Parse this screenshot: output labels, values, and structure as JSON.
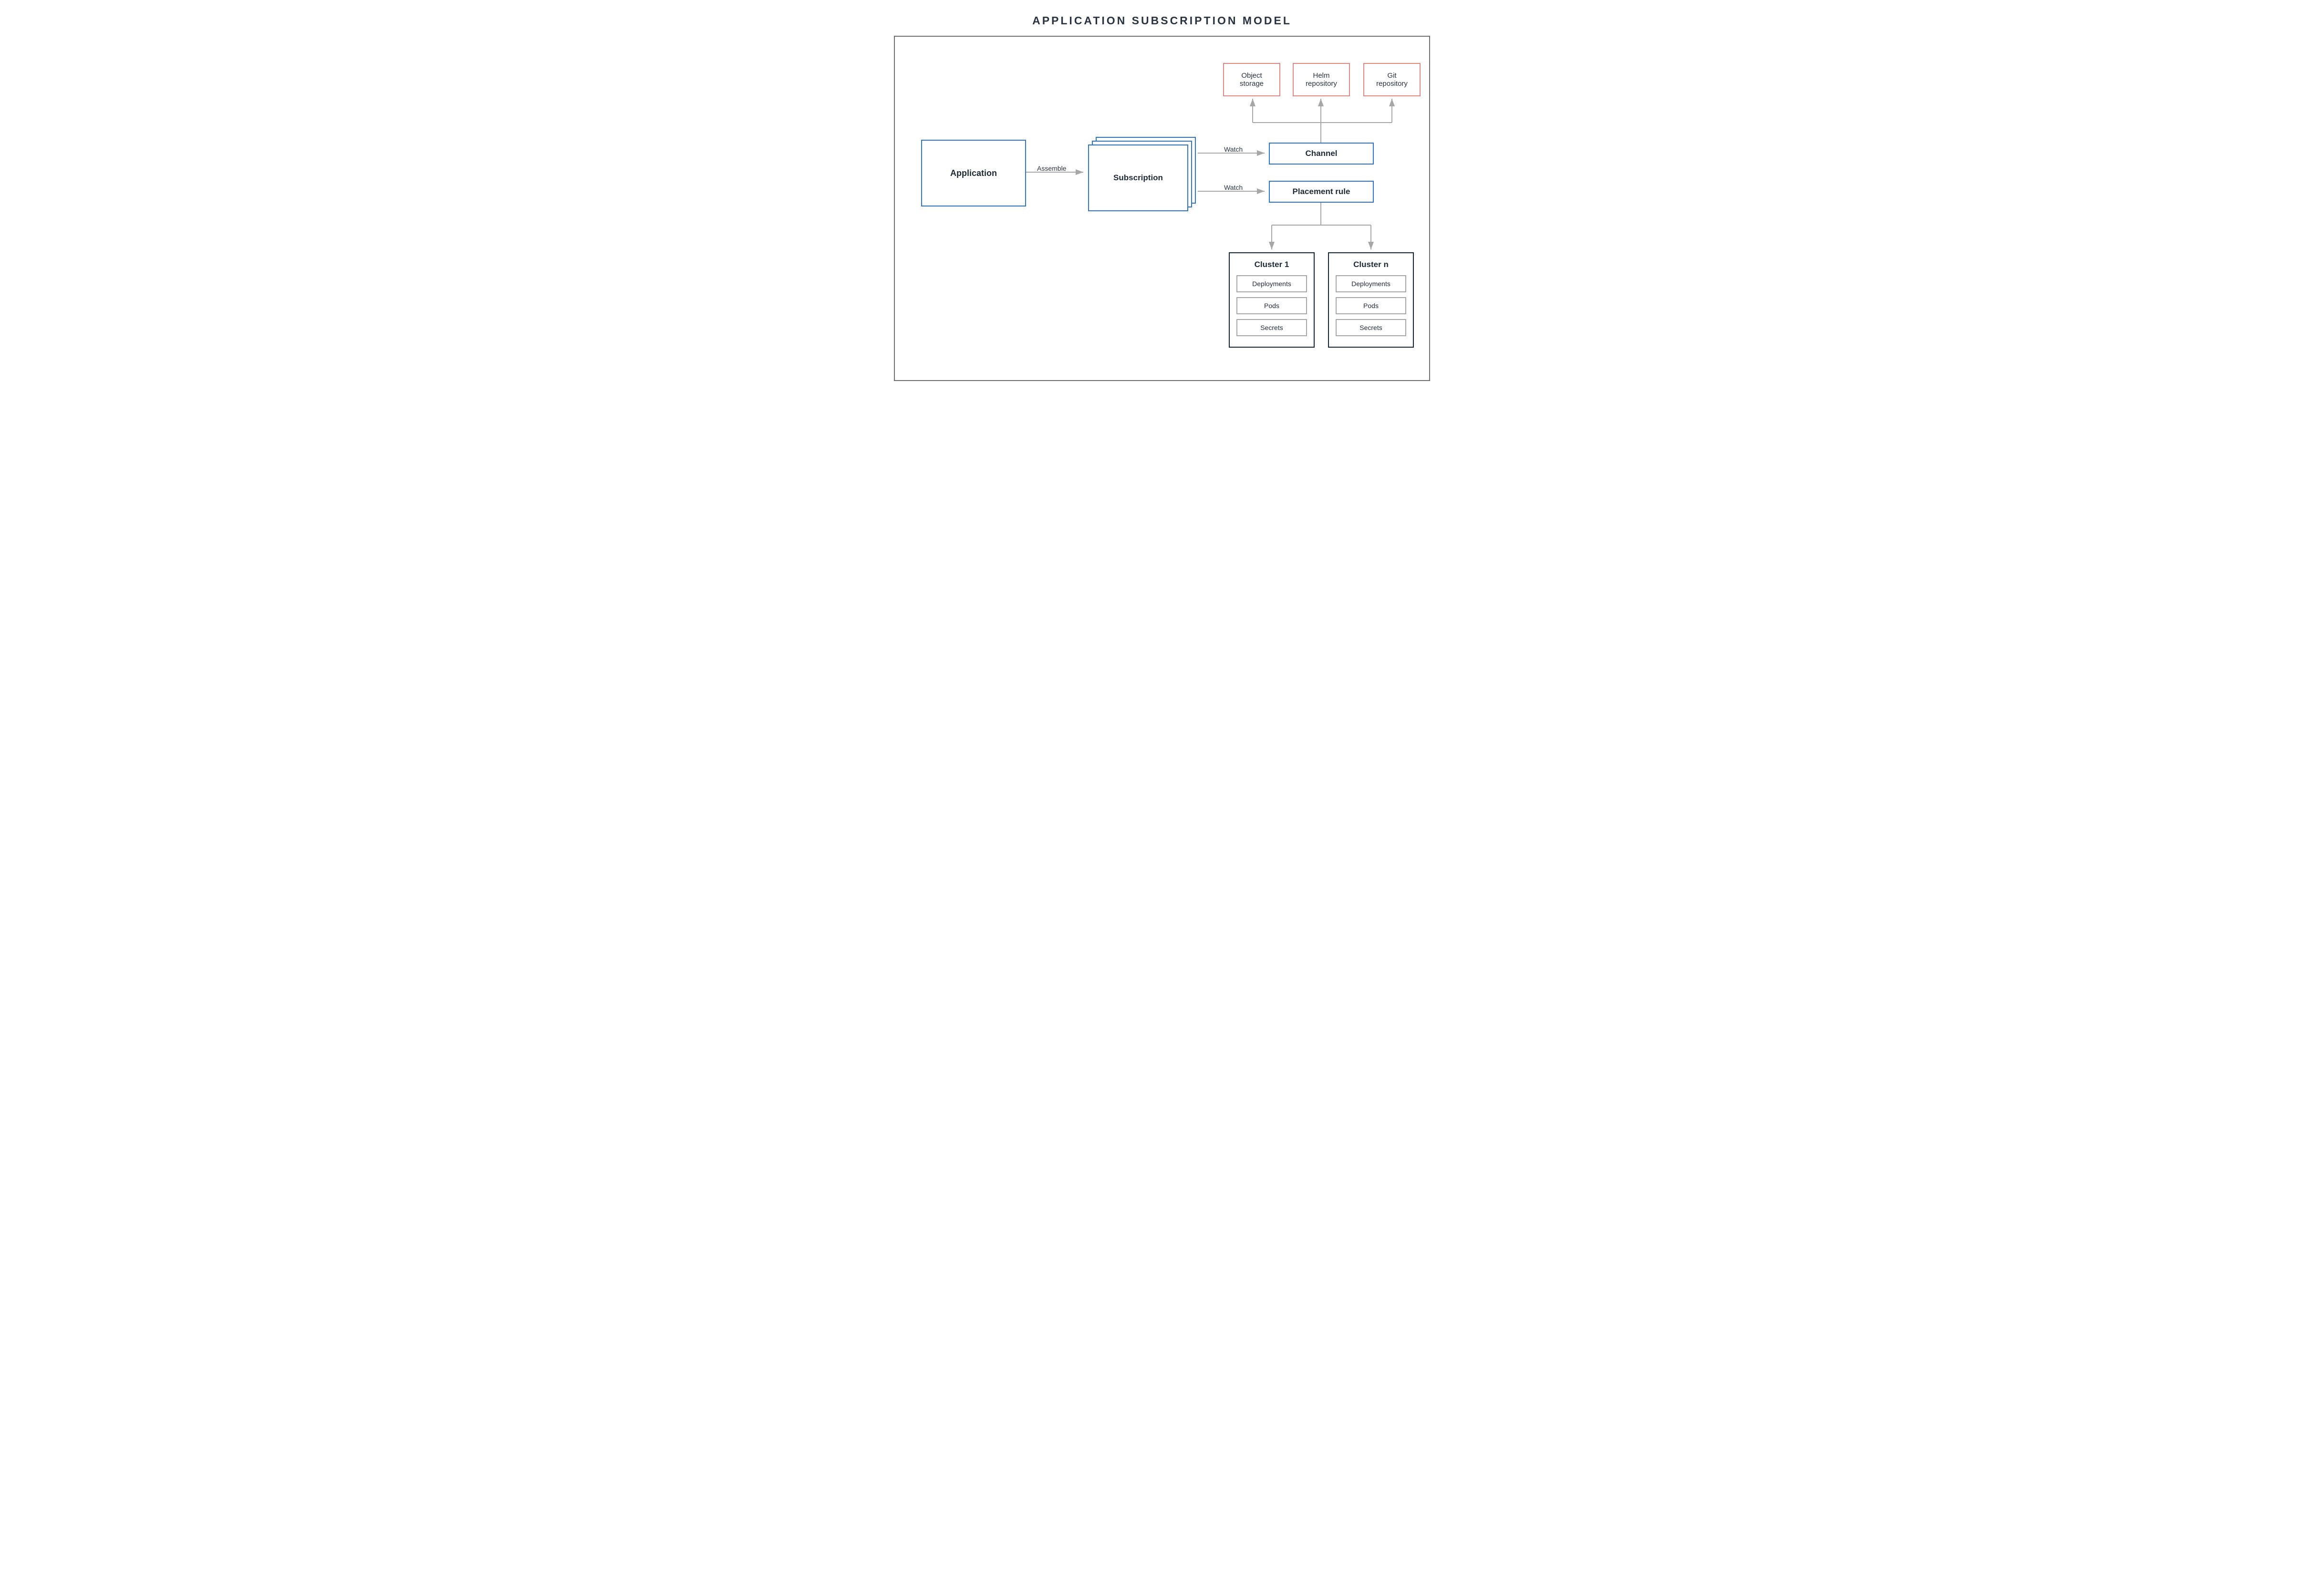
{
  "title": "APPLICATION SUBSCRIPTION MODEL",
  "nodes": {
    "application": "Application",
    "subscription": "Subscription",
    "channel": "Channel",
    "placement": "Placement rule",
    "repos": {
      "object": "Object\nstorage",
      "helm": "Helm\nrepository",
      "git": "Git\nrepository"
    },
    "cluster1": {
      "title": "Cluster 1",
      "items": [
        "Deployments",
        "Pods",
        "Secrets"
      ]
    },
    "clusterN": {
      "title": "Cluster n",
      "items": [
        "Deployments",
        "Pods",
        "Secrets"
      ]
    }
  },
  "edges": {
    "assemble": "Assemble",
    "watch1": "Watch",
    "watch2": "Watch"
  },
  "colors": {
    "blue": "#2f74d0",
    "red": "#e08a86",
    "dark": "#14253a",
    "gray": "#a7a7a7"
  }
}
